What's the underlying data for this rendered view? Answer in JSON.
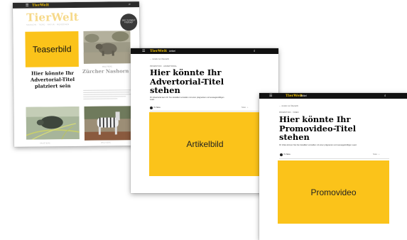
{
  "teaser_card": {
    "brand": "TierWelt",
    "tagline": "MAGAZIN · TIERE · NATUR · MENSCHEN",
    "badge": "DER TIERWELT PODCAST",
    "teaser_image_label": "Teaserbild",
    "teaser_title": "Hier könnte Ihr Advertorial-Titel platziert sein",
    "story_kicker": "WILDTIERE",
    "story_title": "Zürcher Nashorn frischt Genpool in Ruanda auf",
    "caption_left": "HAUSTIERE",
    "caption_right": "WILDTIERE"
  },
  "advertorial_card": {
    "brand": "TierWelt",
    "nav": "Artikel",
    "back": "← zurück zur Übersicht",
    "kicker": "PROMOTION · ADVERTORIAL",
    "title": "Hier könnte Ihr Advertorial-Titel stehen",
    "lead": "Ihr Advertorial kann Ihr Text detailliert vorstellen mit einer prägnanten und aussagekräftigen Lead.",
    "author": "Ihr Name",
    "share": "Teilen  ·  ⟂",
    "media_label": "Artikelbild"
  },
  "promo_card": {
    "brand": "TierWelt",
    "nav": "Artikel",
    "back": "← zurück zur Übersicht",
    "kicker": "PROMOTION · VIDEO",
    "title": "Hier könnte Ihr Promovideo-Titel stehen",
    "lead": "Ihr Video können Sie hier detailliert vorstellen mit einer prägnanten und aussagekräftigen Lead.",
    "author": "Ihr Name",
    "share": "Teilen  ·  ⟂",
    "media_label": "Promovideo"
  },
  "colors": {
    "accent_yellow": "#fbc31a",
    "dark_bar": "#111111"
  },
  "icons": [
    "menu-icon",
    "search-icon",
    "avatar-icon"
  ]
}
